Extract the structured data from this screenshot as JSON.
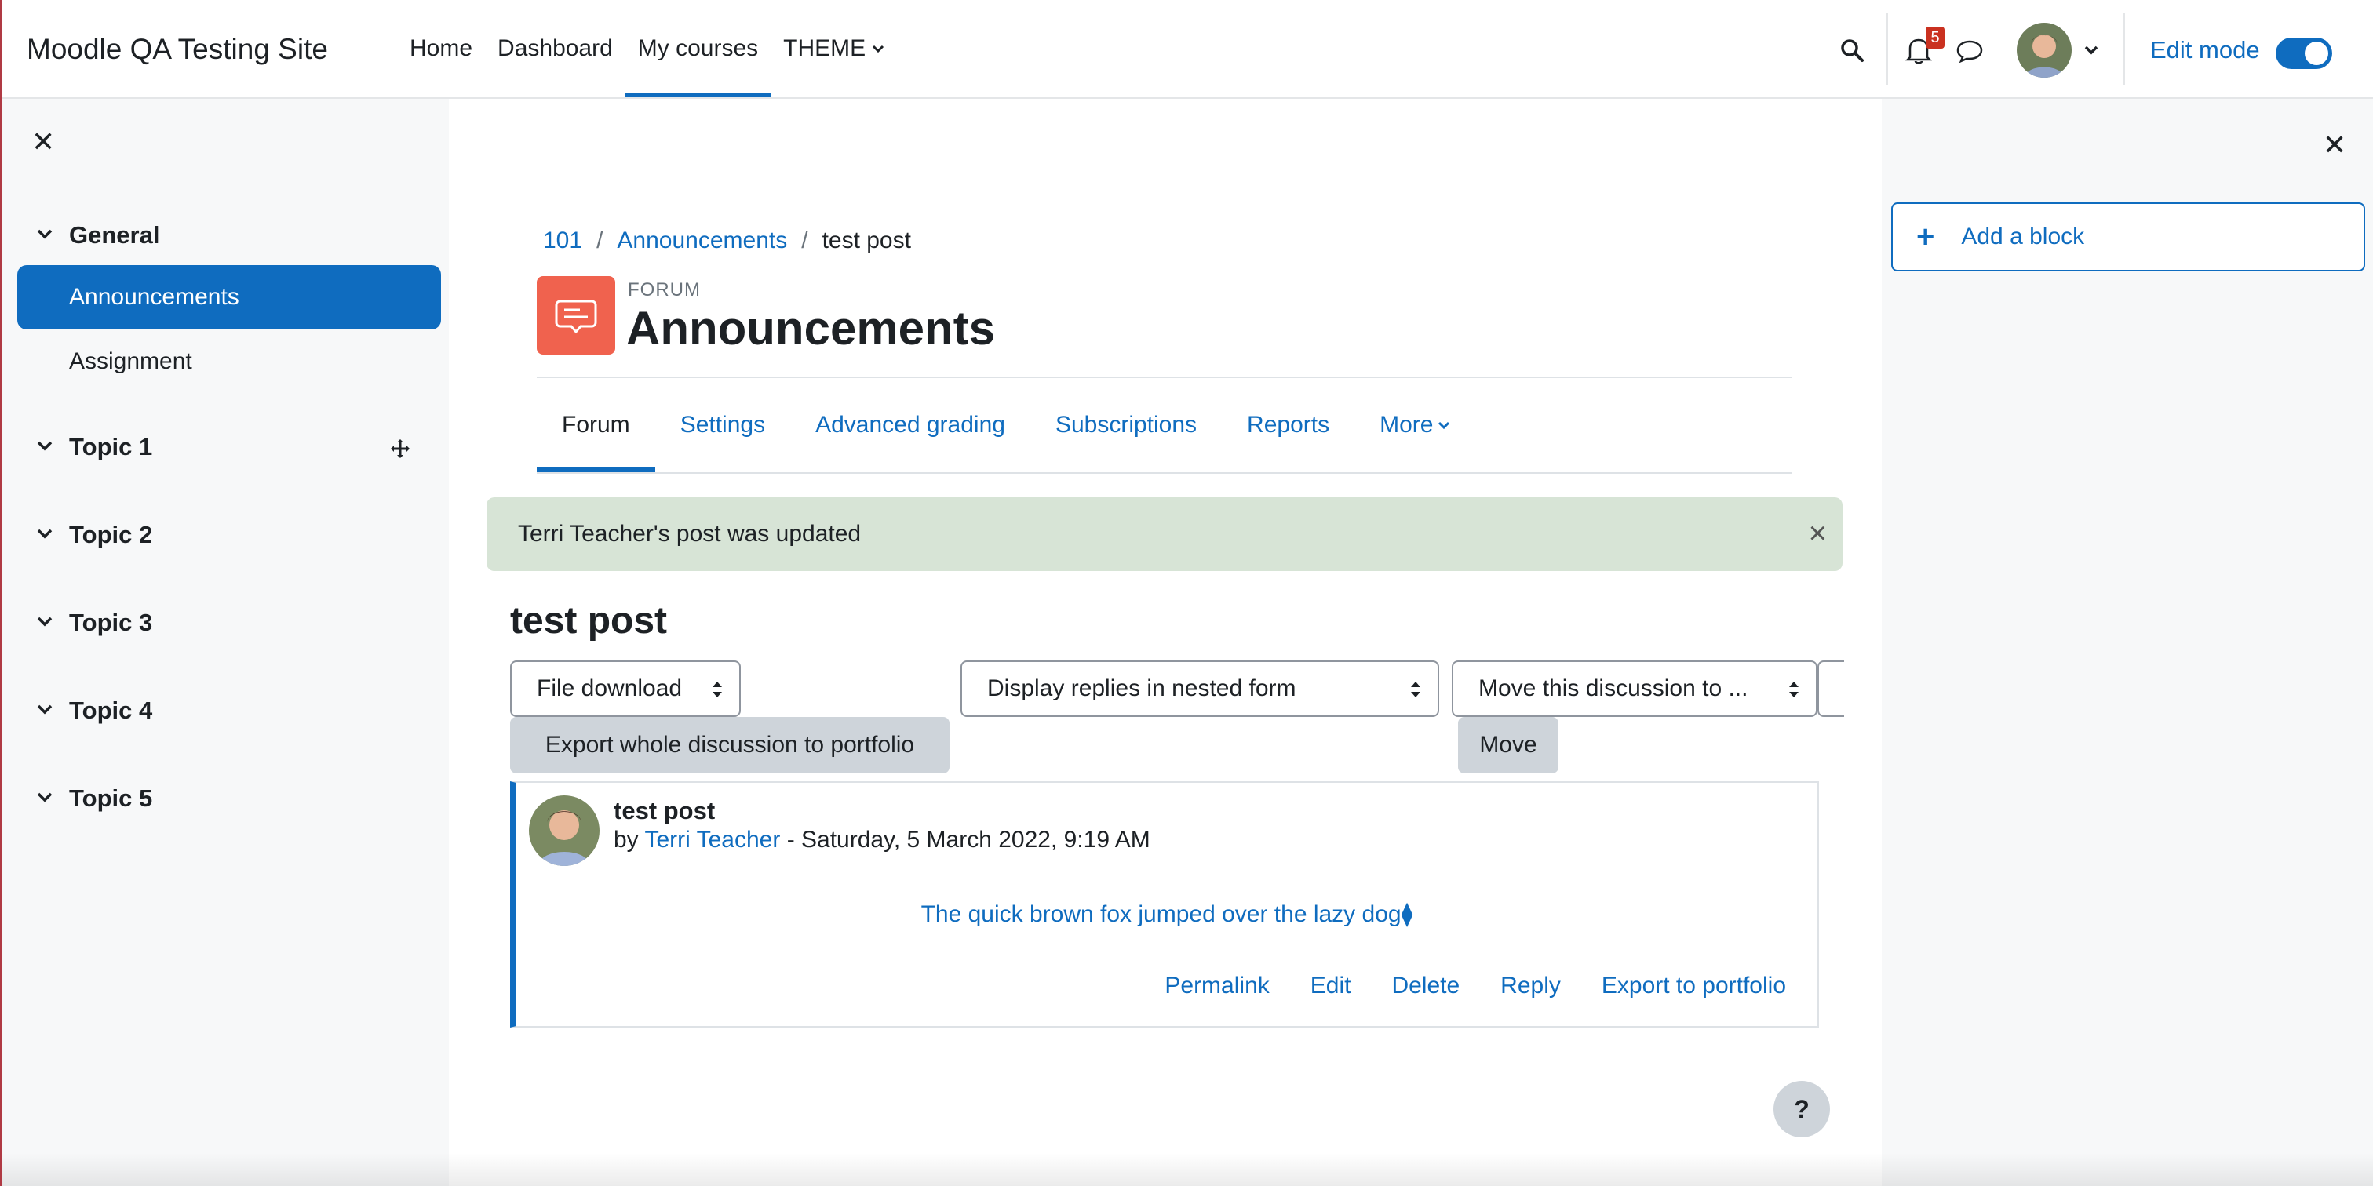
{
  "navbar": {
    "site_name": "Moodle QA Testing Site",
    "links": [
      "Home",
      "Dashboard",
      "My courses",
      "THEME"
    ],
    "active_link": "My courses",
    "notification_count": "5",
    "edit_mode_label": "Edit mode",
    "edit_mode_on": true
  },
  "course_index": {
    "sections": [
      {
        "title": "General",
        "items": [
          "Announcements",
          "Assignment"
        ]
      },
      {
        "title": "Topic 1"
      },
      {
        "title": "Topic 2"
      },
      {
        "title": "Topic 3"
      },
      {
        "title": "Topic 4"
      },
      {
        "title": "Topic 5"
      }
    ],
    "active_item": "Announcements"
  },
  "blocks": {
    "add_block_label": "Add a block"
  },
  "breadcrumb": [
    "101",
    "Announcements",
    "test post"
  ],
  "activity": {
    "type_label": "FORUM",
    "title": "Announcements"
  },
  "tabs": [
    "Forum",
    "Settings",
    "Advanced grading",
    "Subscriptions",
    "Reports",
    "More"
  ],
  "active_tab": "Forum",
  "alert": {
    "message": "Terri Teacher's post was updated"
  },
  "discussion": {
    "title": "test post",
    "controls": {
      "file_download": "File download",
      "display_mode": "Display replies in nested form",
      "move_to": "Move this discussion to ...",
      "export_button": "Export whole discussion to portfolio",
      "move_button": "Move"
    },
    "post": {
      "subject": "test post",
      "by": "by",
      "author": "Terri Teacher",
      "date": "- Saturday, 5 March 2022, 9:19 AM",
      "body": "The quick brown fox jumped over the lazy dog⧫",
      "actions": [
        "Permalink",
        "Edit",
        "Delete",
        "Reply",
        "Export to portfolio"
      ]
    }
  },
  "help_button": "?",
  "colors": {
    "primary": "#0f6cbf",
    "forum_icon": "#f0624e",
    "alert_success": "#d7e4d6",
    "badge": "#ca3120"
  }
}
